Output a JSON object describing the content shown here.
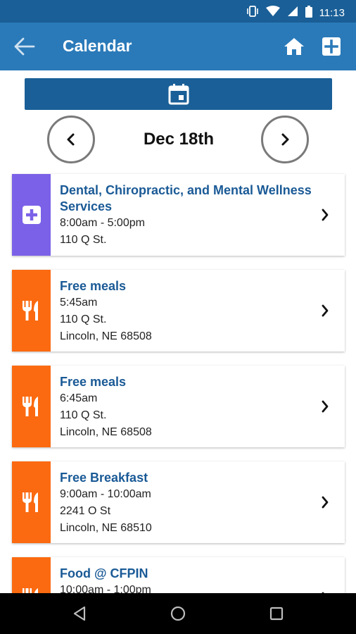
{
  "status_bar": {
    "time": "11:13",
    "icons": [
      "vibrate-icon",
      "wifi-icon",
      "signal-icon",
      "battery-icon"
    ]
  },
  "app_bar": {
    "title": "Calendar",
    "back_icon": "arrow-left-icon",
    "home_icon": "home-icon",
    "add_icon": "plus-square-icon",
    "background": "#2a7ab9"
  },
  "date_nav": {
    "calendar_icon": "calendar-icon",
    "current_date": "Dec 18th",
    "prev_icon": "chevron-left-icon",
    "next_icon": "chevron-right-icon"
  },
  "events": [
    {
      "title": "Dental, Chiropractic, and Mental Wellness Services",
      "time": "8:00am - 5:00pm",
      "address": "110 Q St.",
      "city": "",
      "category_icon": "medical-plus-icon",
      "color": "#7b61e8"
    },
    {
      "title": "Free meals",
      "time": "5:45am",
      "address": "110 Q St.",
      "city": "Lincoln, NE 68508",
      "category_icon": "fork-knife-icon",
      "color": "#fb6a10"
    },
    {
      "title": "Free meals",
      "time": "6:45am",
      "address": "110 Q St.",
      "city": "Lincoln, NE 68508",
      "category_icon": "fork-knife-icon",
      "color": "#fb6a10"
    },
    {
      "title": "Free Breakfast",
      "time": "9:00am - 10:00am",
      "address": "2241 O St",
      "city": "Lincoln, NE 68510",
      "category_icon": "fork-knife-icon",
      "color": "#fb6a10"
    },
    {
      "title": "Food @ CFPIN",
      "time": "10:00am - 1:00pm",
      "address": "",
      "city": "",
      "category_icon": "fork-knife-icon",
      "color": "#fb6a10"
    }
  ],
  "nav_bar": {
    "icons": [
      "back-triangle-icon",
      "home-circle-icon",
      "recents-square-icon"
    ]
  }
}
